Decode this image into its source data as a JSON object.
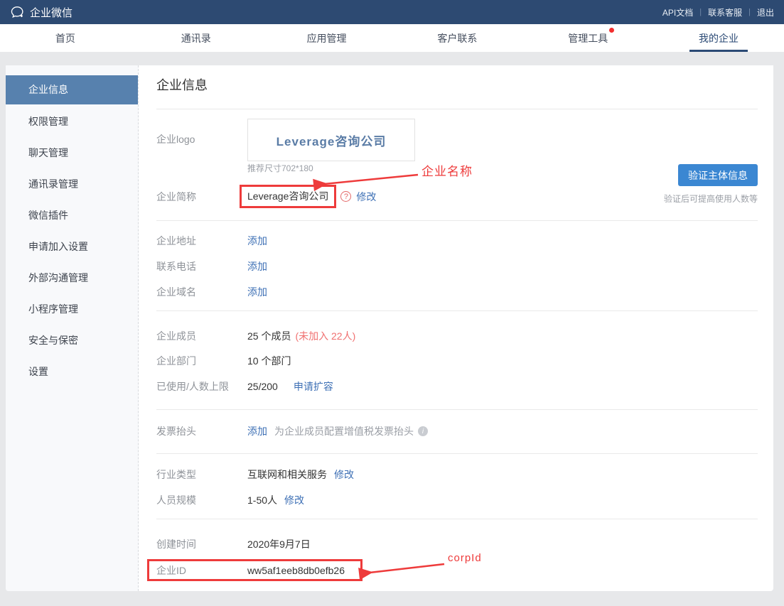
{
  "topbar": {
    "brand": "企业微信",
    "links": [
      "API文档",
      "联系客服",
      "退出"
    ]
  },
  "nav": {
    "items": [
      {
        "label": "首页",
        "active": false
      },
      {
        "label": "通讯录",
        "active": false
      },
      {
        "label": "应用管理",
        "active": false
      },
      {
        "label": "客户联系",
        "active": false
      },
      {
        "label": "管理工具",
        "active": false,
        "badge": true
      },
      {
        "label": "我的企业",
        "active": true
      }
    ]
  },
  "sidebar": {
    "items": [
      {
        "label": "企业信息",
        "active": true
      },
      {
        "label": "权限管理",
        "active": false
      },
      {
        "label": "聊天管理",
        "active": false
      },
      {
        "label": "通讯录管理",
        "active": false
      },
      {
        "label": "微信插件",
        "active": false
      },
      {
        "label": "申请加入设置",
        "active": false
      },
      {
        "label": "外部沟通管理",
        "active": false
      },
      {
        "label": "小程序管理",
        "active": false
      },
      {
        "label": "安全与保密",
        "active": false
      },
      {
        "label": "设置",
        "active": false
      }
    ]
  },
  "main": {
    "title": "企业信息",
    "logo": {
      "label": "企业logo",
      "text": "Leverage咨询公司",
      "hint": "推荐尺寸702*180"
    },
    "verify": {
      "button": "验证主体信息",
      "hint": "验证后可提高使用人数等"
    },
    "shortname": {
      "label": "企业简称",
      "value": "Leverage咨询公司",
      "action": "修改",
      "help_icon": "?"
    },
    "address": {
      "label": "企业地址",
      "action": "添加"
    },
    "phone": {
      "label": "联系电话",
      "action": "添加"
    },
    "domain": {
      "label": "企业域名",
      "action": "添加"
    },
    "members": {
      "label": "企业成员",
      "value": "25 个成员",
      "extra": "(未加入 22人)"
    },
    "departments": {
      "label": "企业部门",
      "value": "10 个部门"
    },
    "usage": {
      "label": "已使用/人数上限",
      "value": "25/200",
      "action": "申请扩容"
    },
    "invoice": {
      "label": "发票抬头",
      "action": "添加",
      "desc": "为企业成员配置增值税发票抬头",
      "info_icon": "i"
    },
    "industry": {
      "label": "行业类型",
      "value": "互联网和相关服务",
      "action": "修改"
    },
    "scale": {
      "label": "人员规模",
      "value": "1-50人",
      "action": "修改"
    },
    "created": {
      "label": "创建时间",
      "value": "2020年9月7日"
    },
    "corpid": {
      "label": "企业ID",
      "value": "ww5af1eeb8db0efb26"
    }
  },
  "annotations": {
    "company_name": "企业名称",
    "corp_id": "corpId"
  },
  "colors": {
    "topbar_bg": "#2d4a72",
    "nav_active": "#2b4a75",
    "sidebar_active_bg": "#5781ae",
    "link_blue": "#3e70b5",
    "button_blue": "#3b87d2",
    "annotation_red": "#ee3b3b",
    "warning_pink": "#f07070",
    "logo_text_blue": "#5a7ca6"
  }
}
